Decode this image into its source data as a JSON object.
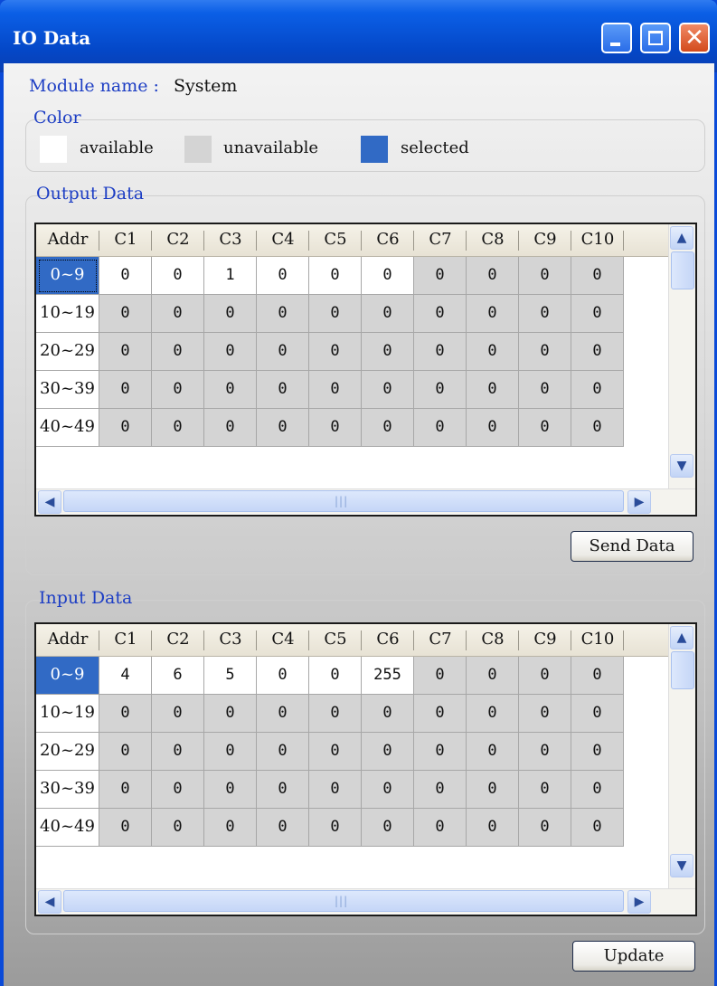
{
  "window": {
    "title": "IO Data"
  },
  "module": {
    "label": "Module name :",
    "value": "System"
  },
  "color_group": {
    "legend": "Color",
    "items": [
      {
        "label": "available",
        "swatch": "#ffffff"
      },
      {
        "label": "unavailable",
        "swatch": "#d4d4d4"
      },
      {
        "label": "selected",
        "swatch": "#316ac5"
      }
    ]
  },
  "columns": [
    "Addr",
    "C1",
    "C2",
    "C3",
    "C4",
    "C5",
    "C6",
    "C7",
    "C8",
    "C9",
    "C10"
  ],
  "output": {
    "legend": "Output Data",
    "button": "Send Data",
    "rows": [
      {
        "addr": "0~9",
        "selected": true,
        "values": [
          "0",
          "0",
          "1",
          "0",
          "0",
          "0",
          "0",
          "0",
          "0",
          "0"
        ]
      },
      {
        "addr": "10~19",
        "selected": false,
        "values": [
          "0",
          "0",
          "0",
          "0",
          "0",
          "0",
          "0",
          "0",
          "0",
          "0"
        ]
      },
      {
        "addr": "20~29",
        "selected": false,
        "values": [
          "0",
          "0",
          "0",
          "0",
          "0",
          "0",
          "0",
          "0",
          "0",
          "0"
        ]
      },
      {
        "addr": "30~39",
        "selected": false,
        "values": [
          "0",
          "0",
          "0",
          "0",
          "0",
          "0",
          "0",
          "0",
          "0",
          "0"
        ]
      },
      {
        "addr": "40~49",
        "selected": false,
        "values": [
          "0",
          "0",
          "0",
          "0",
          "0",
          "0",
          "0",
          "0",
          "0",
          "0"
        ]
      }
    ],
    "available_cols": 6
  },
  "input": {
    "legend": "Input Data",
    "button": "Update",
    "rows": [
      {
        "addr": "0~9",
        "selected": true,
        "values": [
          "4",
          "6",
          "5",
          "0",
          "0",
          "255",
          "0",
          "0",
          "0",
          "0"
        ]
      },
      {
        "addr": "10~19",
        "selected": false,
        "values": [
          "0",
          "0",
          "0",
          "0",
          "0",
          "0",
          "0",
          "0",
          "0",
          "0"
        ]
      },
      {
        "addr": "20~29",
        "selected": false,
        "values": [
          "0",
          "0",
          "0",
          "0",
          "0",
          "0",
          "0",
          "0",
          "0",
          "0"
        ]
      },
      {
        "addr": "30~39",
        "selected": false,
        "values": [
          "0",
          "0",
          "0",
          "0",
          "0",
          "0",
          "0",
          "0",
          "0",
          "0"
        ]
      },
      {
        "addr": "40~49",
        "selected": false,
        "values": [
          "0",
          "0",
          "0",
          "0",
          "0",
          "0",
          "0",
          "0",
          "0",
          "0"
        ]
      }
    ],
    "available_cols": 6
  },
  "icons": {
    "scroll_up": "▲",
    "scroll_down": "▼",
    "scroll_left": "◀",
    "scroll_right": "▶",
    "minimize": "minimize-icon",
    "maximize": "maximize-icon",
    "close": "✕"
  }
}
